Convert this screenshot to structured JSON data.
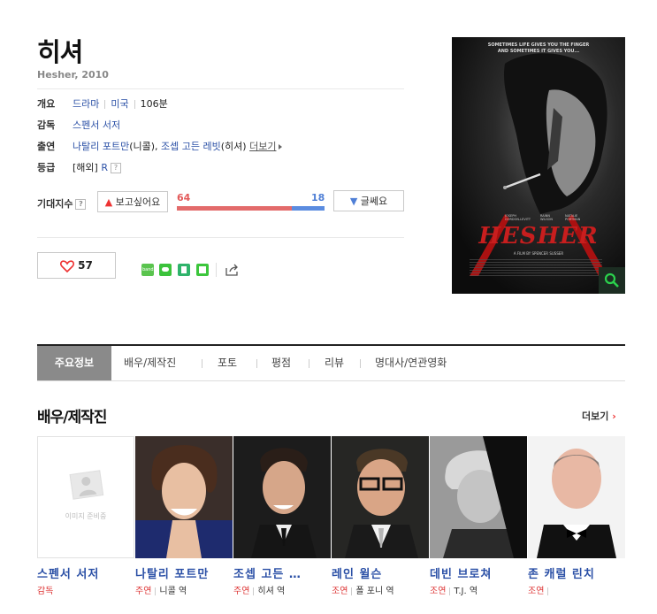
{
  "movie": {
    "title": "히셔",
    "subtitle": "Hesher, 2010"
  },
  "info": {
    "overview_label": "개요",
    "genre": "드라마",
    "country": "미국",
    "runtime": "106분",
    "director_label": "감독",
    "director": "스펜서 서저",
    "cast_label": "출연",
    "cast_1": "나탈리 포트만",
    "cast_1_role": "(니콜),",
    "cast_2": "조셉 고든 레빗",
    "cast_2_role": "(히셔)",
    "cast_more": "더보기",
    "rating_label": "등급",
    "rating_prefix": "[해외]",
    "rating": "R",
    "help_mark": "?"
  },
  "expectation": {
    "label": "기대지수",
    "want_label": "보고싶어요",
    "not_label": "글쎄요",
    "want_count": "64",
    "not_count": "18",
    "want_ratio": 0.78
  },
  "like": {
    "count": "57"
  },
  "share": [
    {
      "name": "band-icon",
      "color": "#5ac44e"
    },
    {
      "name": "line-icon",
      "color": "#3bc23b"
    },
    {
      "name": "bookmark-icon",
      "color": "#2fb36b"
    },
    {
      "name": "square-icon",
      "color": "#3cc63c"
    }
  ],
  "poster": {
    "tagline_1": "SOMETIMES LIFE GIVES YOU THE FINGER",
    "tagline_2": "AND SOMETIMES IT GIVES YOU...",
    "actor_1": "JOSEPH GORDON-LEVITT",
    "actor_2": "RAINN WILSON",
    "actor_3": "NATALIE PORTMAN",
    "movie_name": "HESHER",
    "credit": "A FILM BY SPENCER SUSSER"
  },
  "tabs": [
    "주요정보",
    "배우/제작진",
    "포토",
    "평점",
    "리뷰",
    "명대사/연관영화"
  ],
  "section": {
    "title": "배우/제작진",
    "more": "더보기"
  },
  "placeholder_text": "이미지 준비중",
  "cast": [
    {
      "name": "스펜서 서저",
      "kind": "감독",
      "role": ""
    },
    {
      "name": "나탈리 포트만",
      "kind": "주연",
      "role": "니콜 역"
    },
    {
      "name": "조셉 고든 …",
      "kind": "주연",
      "role": "히셔 역"
    },
    {
      "name": "레인 윌슨",
      "kind": "조연",
      "role": "폴 포니 역"
    },
    {
      "name": "데빈 브로쳐",
      "kind": "조연",
      "role": "T.J. 역"
    },
    {
      "name": "존 캐럴 린치",
      "kind": "조연",
      "role": ""
    }
  ]
}
